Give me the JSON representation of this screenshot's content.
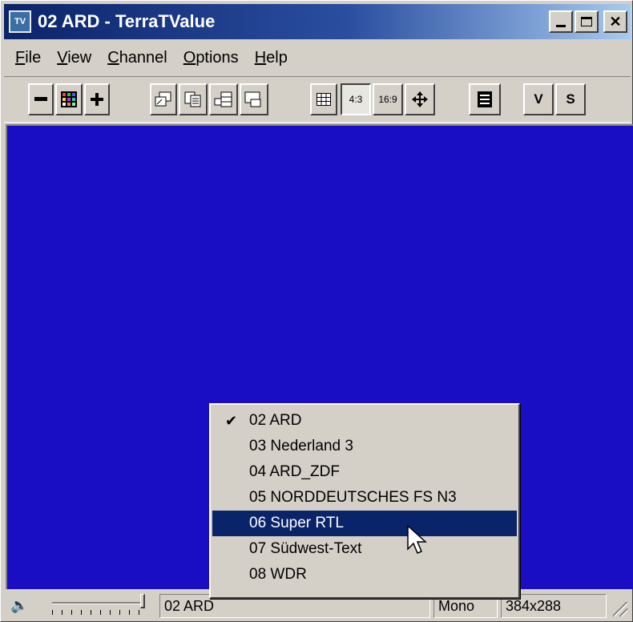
{
  "window": {
    "title": "02 ARD - TerraTValue",
    "app_icon_label": "TV"
  },
  "menu": [
    {
      "label": "File",
      "underline": "F",
      "rest": "ile"
    },
    {
      "label": "View",
      "underline": "V",
      "rest": "iew"
    },
    {
      "label": "Channel",
      "underline": "C",
      "rest": "hannel"
    },
    {
      "label": "Options",
      "underline": "O",
      "rest": "ptions"
    },
    {
      "label": "Help",
      "underline": "H",
      "rest": "elp"
    }
  ],
  "toolbar": {
    "aspect_43": "4:3",
    "aspect_169": "16:9",
    "v_label": "V",
    "s_label": "S"
  },
  "channel_menu": {
    "items": [
      {
        "label": "02 ARD",
        "checked": true,
        "selected": false
      },
      {
        "label": "03 Nederland 3",
        "checked": false,
        "selected": false
      },
      {
        "label": "04 ARD_ZDF",
        "checked": false,
        "selected": false
      },
      {
        "label": "05 NORDDEUTSCHES FS N3",
        "checked": false,
        "selected": false
      },
      {
        "label": "06 Super RTL",
        "checked": false,
        "selected": true
      },
      {
        "label": "07 Südwest-Text",
        "checked": false,
        "selected": false
      },
      {
        "label": "08 WDR",
        "checked": false,
        "selected": false
      }
    ],
    "check_glyph": "✔"
  },
  "status": {
    "channel": "02 ARD",
    "audio": "Mono",
    "resolution": "384x288"
  },
  "colors": {
    "video_background": "#1a0ec4",
    "selection": "#0a246a",
    "titlebar_start": "#0a246a"
  }
}
